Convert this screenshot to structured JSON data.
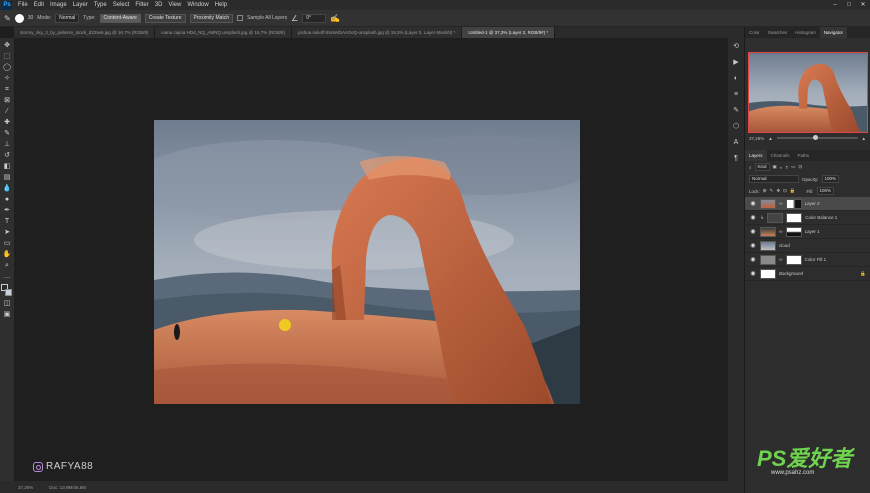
{
  "menubar": {
    "logo": "Ps",
    "items": [
      "File",
      "Edit",
      "Image",
      "Layer",
      "Type",
      "Select",
      "Filter",
      "3D",
      "View",
      "Window",
      "Help"
    ]
  },
  "options": {
    "brush_size": "30",
    "mode_label": "Mode:",
    "mode_value": "Normal",
    "type_label": "Type:",
    "type_buttons": [
      "Content-Aware",
      "Create Texture",
      "Proximity Match"
    ],
    "sample_all_layers": "Sample All Layers",
    "angle": "0°"
  },
  "tabs": [
    "stormy_sky_3_by_pellenm_stock_d22se6.jpg @ 16,7% (RGB/8)",
    "ioana cajina HDd_NQ_AMNQ unsplash.jpg @ 16,7% (RGB/8)",
    "joshua sukoff-tNsW4bAnOoQ-unsplash.jpg @ 18,3% (Layer 0, Layer Mask/8) *",
    "Untitled-1 @ 37,3% (Layer 2, RGB/8#) *"
  ],
  "status": {
    "zoom": "37,26%",
    "doc": "Doc: 13,9M/46,6M"
  },
  "watermark": {
    "handle": "RAFYA88"
  },
  "right_panel": {
    "top_tabs": [
      "Color",
      "Swatches",
      "Histogram",
      "Navigator"
    ],
    "nav_zoom": "37,26%",
    "layers_tabs": [
      "Layers",
      "Channels",
      "Paths"
    ],
    "kind": "Kind",
    "blend": "Normal",
    "opacity_label": "Opacity:",
    "opacity": "100%",
    "lock_label": "Lock:",
    "fill_label": "Fill:",
    "fill": "100%",
    "layers": [
      {
        "name": "Layer 2",
        "selected": true
      },
      {
        "name": "Color Balance 1",
        "selected": false
      },
      {
        "name": "Layer 1",
        "selected": false
      },
      {
        "name": "cloud",
        "selected": false
      },
      {
        "name": "Color Fill 1",
        "selected": false
      },
      {
        "name": "Background",
        "selected": false
      }
    ]
  },
  "site_logo": {
    "main": "PS爱好者",
    "sub": "www.psahz.com"
  },
  "colors": {
    "accent": "#e04646",
    "logo_green": "#6fd34f",
    "rock": "#c0623e",
    "sky": "#8a97a8"
  }
}
